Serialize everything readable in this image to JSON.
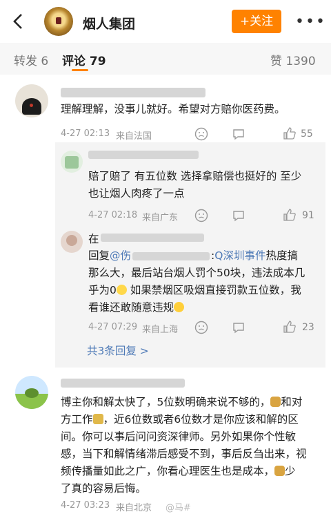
{
  "header": {
    "account_name": "烟人集团",
    "follow_label": "+关注",
    "more_label": "•••"
  },
  "tabs": {
    "repost": "转发 6",
    "comments": "评论 79",
    "likes": "赞 1390"
  },
  "comment1": {
    "text": "理解理解，没事儿就好。希望对方赔你医药费。",
    "time": "4-27 02:13",
    "location": "来自法国",
    "likes": "55"
  },
  "reply1": {
    "line1": "赔了赔了 有五位数 选择拿赔偿也挺好的 至少",
    "line2": "也让烟人肉疼了一点",
    "time": "4-27 02:18",
    "location": "来自广东",
    "likes": "91"
  },
  "reply2": {
    "name_prefix": "在",
    "reply_prefix": "回复",
    "mention": "@伤",
    "colon": ":",
    "topic": "Q深圳事件",
    "line1_tail": "热度搞",
    "line2": "那么大，最后站台烟人罚个50块，违法成本几",
    "line3": "乎为0",
    "line3_tail": " 如果禁烟区吸烟直接罚款五位数，我",
    "line4": "看谁还敢随意违规",
    "time": "4-27 07:29",
    "location": "来自上海",
    "likes": "23",
    "more_replies": "共3条回复 >"
  },
  "comment2": {
    "line1": "博主你和解太快了，5位数明确来说不够的，",
    "line1_tail": "和对",
    "line2": "方工作",
    "line2_tail": "，近6位数或者6位数才是你应该和解的区",
    "line3": "间。你可以事后问问资深律师。另外如果你个性敏",
    "line4": "感，当下和解情绪滞后感受不到，事后反刍出来，视",
    "line5": "频传播量如此之广，你看心理医生也是成本，",
    "line5_tail": "少",
    "line6": "了真的容易后悔。",
    "time": "4-27 03:23",
    "location": "来自北京"
  },
  "watermark": "@马#"
}
